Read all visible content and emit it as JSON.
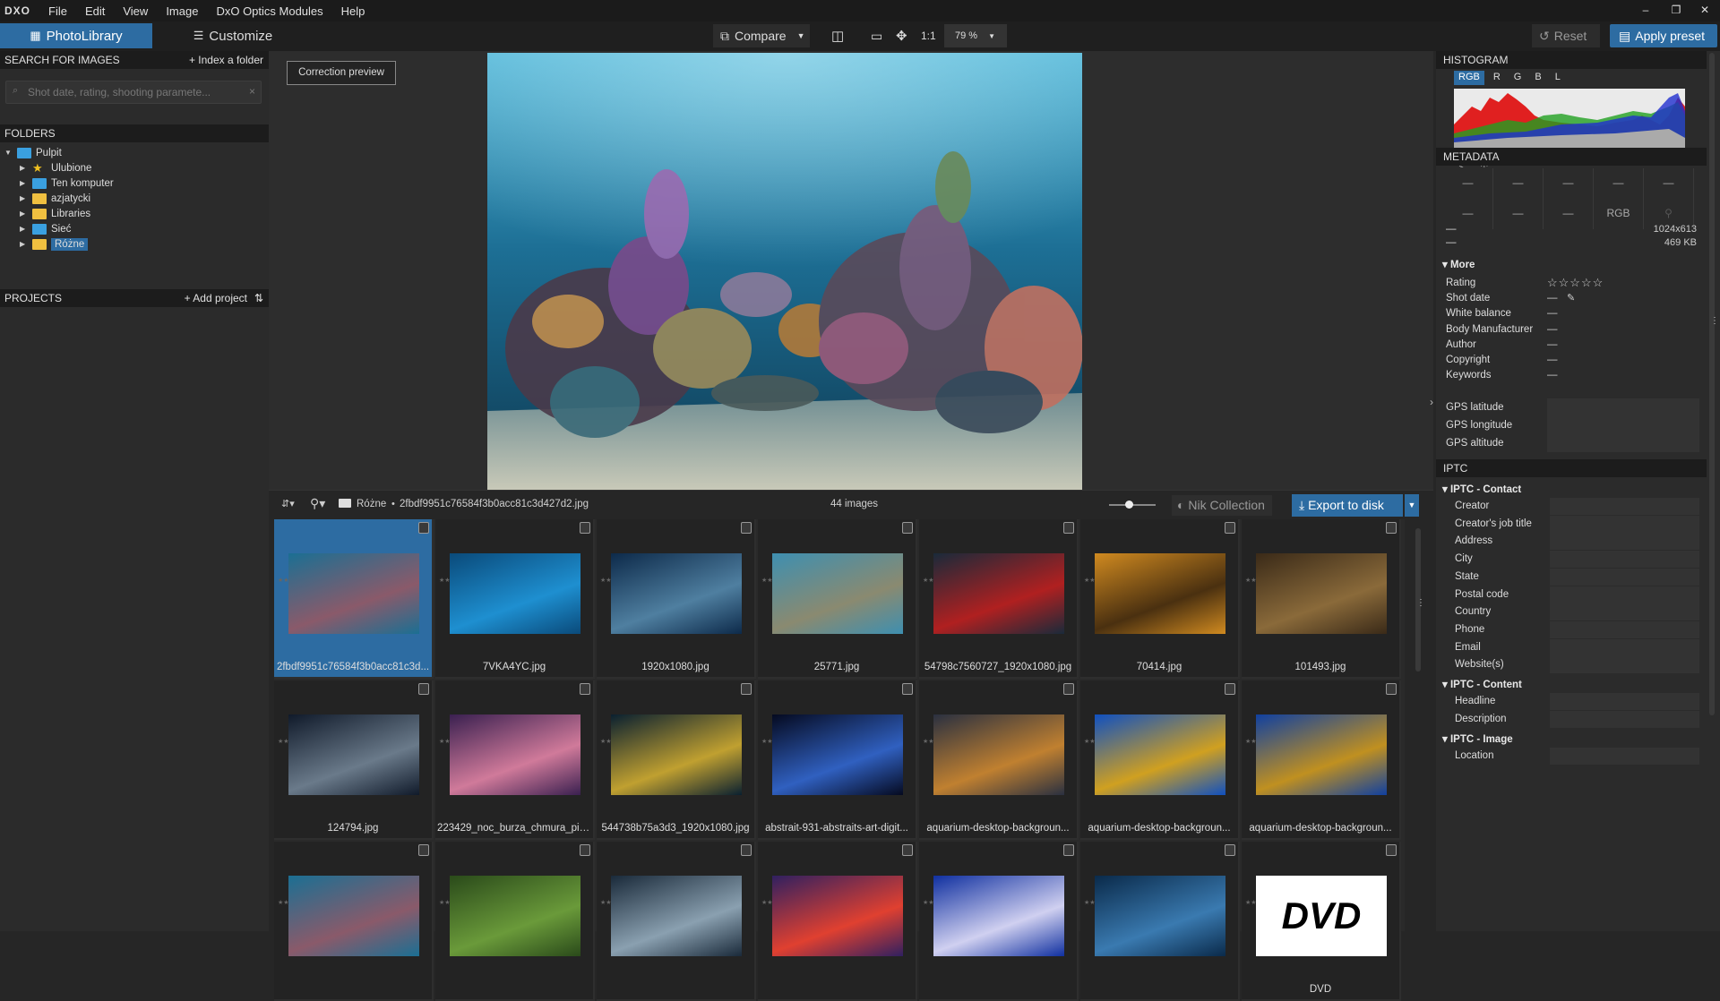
{
  "menubar": {
    "logo": "DXO",
    "items": [
      "File",
      "Edit",
      "View",
      "Image",
      "DxO Optics Modules",
      "Help"
    ],
    "win_minimize": "–",
    "win_restore": "❐",
    "win_close": "✕"
  },
  "tabs": {
    "photolibrary": "PhotoLibrary",
    "customize": "Customize"
  },
  "toolbar": {
    "compare": "Compare",
    "one_to_one": "1:1",
    "zoom": "79 %",
    "reset": "Reset",
    "apply_preset": "Apply preset"
  },
  "left": {
    "search_header": "SEARCH FOR IMAGES",
    "index_folder": "+ Index a folder",
    "search_placeholder": "Shot date, rating, shooting paramete...",
    "folders_header": "FOLDERS",
    "folders": [
      {
        "label": "Pulpit",
        "expanded": true,
        "icon": "desktop-icon",
        "level": 0
      },
      {
        "label": "Ulubione",
        "icon": "star-icon",
        "level": 1
      },
      {
        "label": "Ten komputer",
        "icon": "computer-icon",
        "level": 1
      },
      {
        "label": "azjatycki",
        "icon": "folder-icon",
        "level": 1
      },
      {
        "label": "Libraries",
        "icon": "folder-icon",
        "level": 1
      },
      {
        "label": "Sieć",
        "icon": "network-icon",
        "level": 1
      },
      {
        "label": "Różne",
        "icon": "folder-icon",
        "level": 1,
        "selected": true
      }
    ],
    "projects_header": "PROJECTS",
    "add_project": "+ Add project"
  },
  "viewer": {
    "correction_preview": "Correction preview"
  },
  "browser": {
    "folder": "Różne",
    "filename": "2fbdf9951c76584f3b0acc81c3d427d2.jpg",
    "count": "44 images",
    "nik": "Nik Collection",
    "export": "Export to disk"
  },
  "thumbnails": [
    {
      "name": "2fbdf9951c76584f3b0acc81c3d...",
      "selected": true,
      "c1": "#1b6f93",
      "c2": "#8a5a6a"
    },
    {
      "name": "7VKA4YC.jpg",
      "c1": "#0a4a7a",
      "c2": "#1e8fd0"
    },
    {
      "name": "1920x1080.jpg",
      "c1": "#0d2a4a",
      "c2": "#4f7fa0"
    },
    {
      "name": "25771.jpg",
      "c1": "#3e8fb0",
      "c2": "#8a8a70"
    },
    {
      "name": "54798c7560727_1920x1080.jpg",
      "c1": "#1a2a3a",
      "c2": "#b02020"
    },
    {
      "name": "70414.jpg",
      "c1": "#d08a20",
      "c2": "#4a3010"
    },
    {
      "name": "101493.jpg",
      "c1": "#3a2a18",
      "c2": "#8a6a3a"
    },
    {
      "name": "124794.jpg",
      "c1": "#101a2a",
      "c2": "#6a7a8a"
    },
    {
      "name": "223429_noc_burza_chmura_pio...",
      "c1": "#3a2050",
      "c2": "#d07a9a"
    },
    {
      "name": "544738b75a3d3_1920x1080.jpg",
      "c1": "#0a2030",
      "c2": "#c0a030"
    },
    {
      "name": "abstrait-931-abstraits-art-digit...",
      "c1": "#050a20",
      "c2": "#3060c0"
    },
    {
      "name": "aquarium-desktop-backgroun...",
      "c1": "#2a3040",
      "c2": "#c08030"
    },
    {
      "name": "aquarium-desktop-backgroun...",
      "c1": "#1050c0",
      "c2": "#d0a020"
    },
    {
      "name": "aquarium-desktop-backgroun...",
      "c1": "#1040a0",
      "c2": "#c09020"
    },
    {
      "name": "",
      "c1": "#1b6f93",
      "c2": "#8a5a6a"
    },
    {
      "name": "",
      "c1": "#2a4a1a",
      "c2": "#6a9a3a"
    },
    {
      "name": "",
      "c1": "#1a2a3a",
      "c2": "#8aa0b0"
    },
    {
      "name": "",
      "c1": "#302060",
      "c2": "#e04030"
    },
    {
      "name": "",
      "c1": "#1030a0",
      "c2": "#d0d0f0"
    },
    {
      "name": "",
      "c1": "#0a2a4a",
      "c2": "#3a7ab0"
    },
    {
      "name": "DVD",
      "c1": "#000000",
      "c2": "#000000"
    }
  ],
  "right": {
    "histogram_header": "HISTOGRAM",
    "channels": [
      "RGB",
      "R",
      "G",
      "B",
      "L"
    ],
    "metadata_header": "METADATA",
    "dash": "—",
    "color_space": "RGB",
    "dimensions": "1024x613",
    "filesize": "469 KB",
    "more": "More",
    "fields": [
      "Rating",
      "Shot date",
      "White balance",
      "Body Manufacturer",
      "Author",
      "Copyright",
      "Keywords"
    ],
    "gps": [
      "GPS latitude",
      "GPS longitude",
      "GPS altitude"
    ],
    "iptc_header": "IPTC",
    "iptc_contact": "IPTC - Contact",
    "contact_fields": [
      "Creator",
      "Creator's job title",
      "Address",
      "City",
      "State",
      "Postal code",
      "Country",
      "Phone",
      "Email",
      "Website(s)"
    ],
    "iptc_content": "IPTC - Content",
    "content_fields": [
      "Headline",
      "Description"
    ],
    "iptc_image": "IPTC - Image",
    "image_fields": [
      "Location"
    ]
  }
}
